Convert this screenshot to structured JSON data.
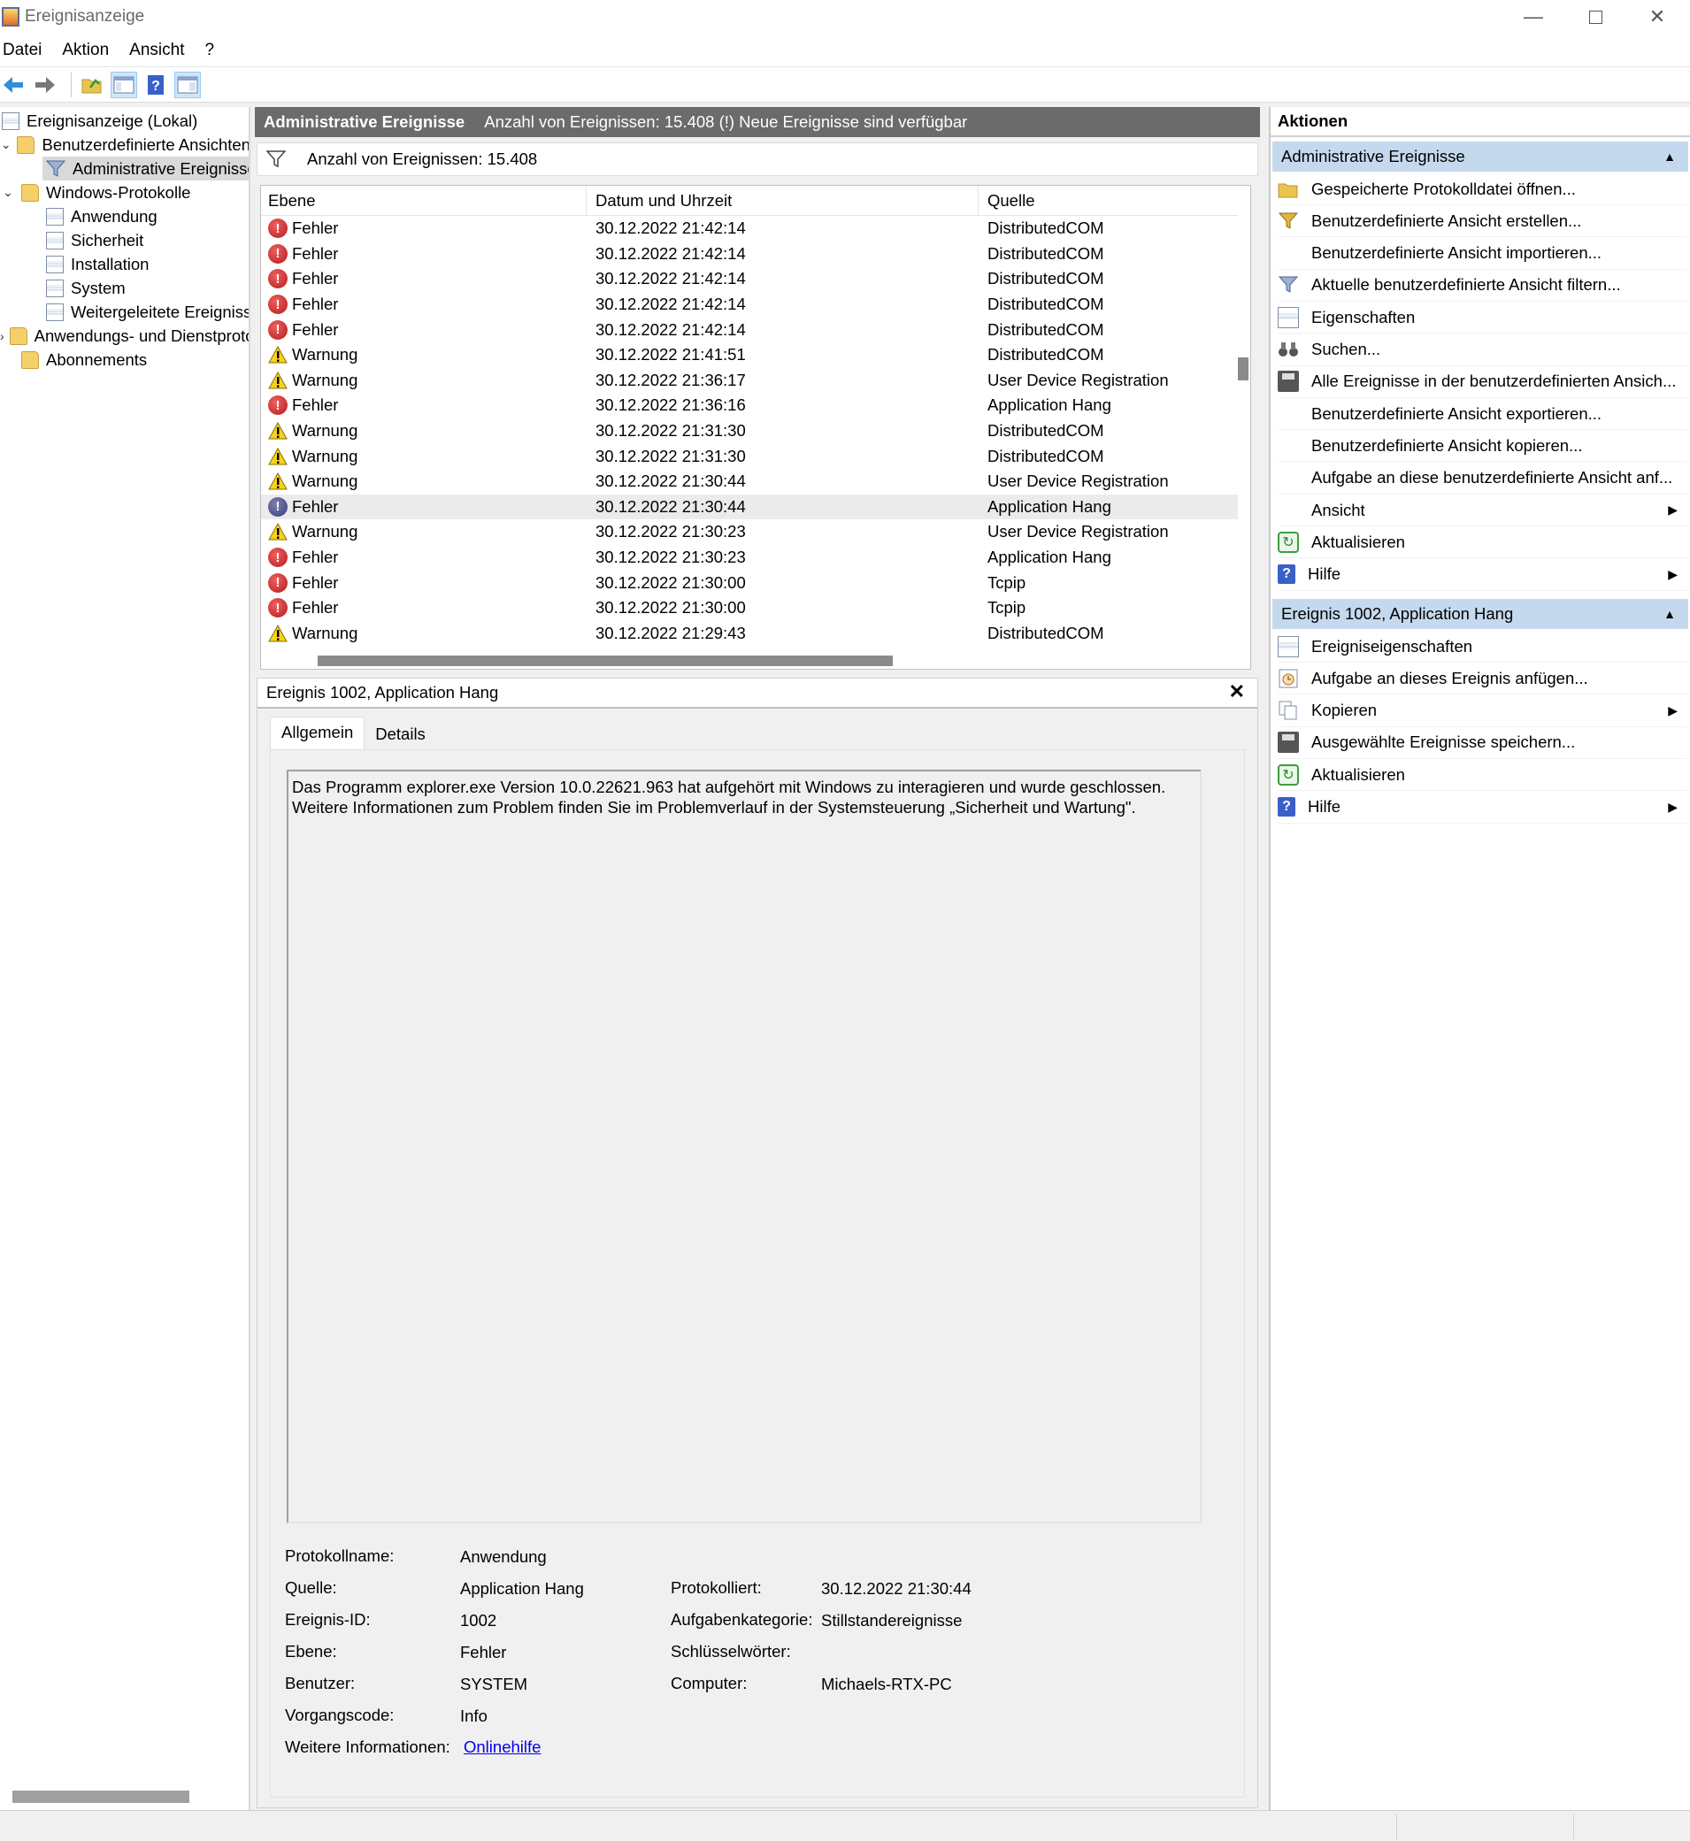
{
  "window": {
    "title": "Ereignisanzeige",
    "minimize_icon": "minimize-icon",
    "maximize_icon": "maximize-icon",
    "close_icon": "close-icon"
  },
  "menu": [
    "Datei",
    "Aktion",
    "Ansicht",
    "?"
  ],
  "toolbar": {
    "icons": [
      "back-arrow-icon",
      "forward-arrow-icon",
      "open-folder-icon",
      "console-tree-icon",
      "help-icon",
      "action-pane-icon"
    ]
  },
  "tree": {
    "root": "Ereignisanzeige (Lokal)",
    "custom_views": "Benutzerdefinierte Ansichten",
    "admin_events": "Administrative Ereignisse",
    "windows_logs": "Windows-Protokolle",
    "logs": [
      "Anwendung",
      "Sicherheit",
      "Installation",
      "System",
      "Weitergeleitete Ereignisse"
    ],
    "app_service_logs": "Anwendungs- und Dienstprotokolle",
    "subscriptions": "Abonnements"
  },
  "center": {
    "header_title": "Administrative Ereignisse",
    "header_info": "Anzahl von Ereignissen: 15.408 (!) Neue Ereignisse sind verfügbar",
    "filter_count": "Anzahl von Ereignissen: 15.408",
    "columns": [
      "Ebene",
      "Datum und Uhrzeit",
      "Quelle"
    ],
    "rows": [
      {
        "level": "Fehler",
        "type": "error",
        "datetime": "30.12.2022 21:42:14",
        "source": "DistributedCOM"
      },
      {
        "level": "Fehler",
        "type": "error",
        "datetime": "30.12.2022 21:42:14",
        "source": "DistributedCOM"
      },
      {
        "level": "Fehler",
        "type": "error",
        "datetime": "30.12.2022 21:42:14",
        "source": "DistributedCOM"
      },
      {
        "level": "Fehler",
        "type": "error",
        "datetime": "30.12.2022 21:42:14",
        "source": "DistributedCOM"
      },
      {
        "level": "Fehler",
        "type": "error",
        "datetime": "30.12.2022 21:42:14",
        "source": "DistributedCOM"
      },
      {
        "level": "Warnung",
        "type": "warning",
        "datetime": "30.12.2022 21:41:51",
        "source": "DistributedCOM"
      },
      {
        "level": "Warnung",
        "type": "warning",
        "datetime": "30.12.2022 21:36:17",
        "source": "User Device Registration"
      },
      {
        "level": "Fehler",
        "type": "error",
        "datetime": "30.12.2022 21:36:16",
        "source": "Application Hang"
      },
      {
        "level": "Warnung",
        "type": "warning",
        "datetime": "30.12.2022 21:31:30",
        "source": "DistributedCOM"
      },
      {
        "level": "Warnung",
        "type": "warning",
        "datetime": "30.12.2022 21:31:30",
        "source": "DistributedCOM"
      },
      {
        "level": "Warnung",
        "type": "warning",
        "datetime": "30.12.2022 21:30:44",
        "source": "User Device Registration"
      },
      {
        "level": "Fehler",
        "type": "error",
        "datetime": "30.12.2022 21:30:44",
        "source": "Application Hang",
        "selected": true
      },
      {
        "level": "Warnung",
        "type": "warning",
        "datetime": "30.12.2022 21:30:23",
        "source": "User Device Registration"
      },
      {
        "level": "Fehler",
        "type": "error",
        "datetime": "30.12.2022 21:30:23",
        "source": "Application Hang"
      },
      {
        "level": "Fehler",
        "type": "error",
        "datetime": "30.12.2022 21:30:00",
        "source": "Tcpip"
      },
      {
        "level": "Fehler",
        "type": "error",
        "datetime": "30.12.2022 21:30:00",
        "source": "Tcpip"
      },
      {
        "level": "Warnung",
        "type": "warning",
        "datetime": "30.12.2022 21:29:43",
        "source": "DistributedCOM"
      }
    ]
  },
  "detail": {
    "title": "Ereignis 1002, Application Hang",
    "tabs": [
      "Allgemein",
      "Details"
    ],
    "description": "Das Programm explorer.exe Version 10.0.22621.963 hat aufgehört mit Windows zu interagieren und wurde geschlossen. Weitere Informationen zum Problem finden Sie im Problemverlauf in der Systemsteuerung „Sicherheit und Wartung\".",
    "labels": {
      "logname": "Protokollname:",
      "source": "Quelle:",
      "event_id": "Ereignis-ID:",
      "level": "Ebene:",
      "user": "Benutzer:",
      "opcode": "Vorgangscode:",
      "more_info": "Weitere Informationen:",
      "logged": "Protokolliert:",
      "task_category": "Aufgabenkategorie:",
      "keywords": "Schlüsselwörter:",
      "computer": "Computer:"
    },
    "values": {
      "logname": "Anwendung",
      "source": "Application Hang",
      "event_id": "1002",
      "level": "Fehler",
      "user": "SYSTEM",
      "opcode": "Info",
      "more_info_link": "Onlinehilfe",
      "logged": "30.12.2022 21:30:44",
      "task_category": "Stillstandereignisse",
      "keywords": "",
      "computer": "Michaels-RTX-PC"
    }
  },
  "actions": {
    "title": "Aktionen",
    "section1": {
      "title": "Administrative Ereignisse",
      "items": [
        {
          "label": "Gespeicherte Protokolldatei öffnen...",
          "icon": "open-folder-icon"
        },
        {
          "label": "Benutzerdefinierte Ansicht erstellen...",
          "icon": "create-filter-icon"
        },
        {
          "label": "Benutzerdefinierte Ansicht importieren...",
          "icon": ""
        },
        {
          "label": "Aktuelle benutzerdefinierte Ansicht filtern...",
          "icon": "filter-icon"
        },
        {
          "label": "Eigenschaften",
          "icon": "properties-icon"
        },
        {
          "label": "Suchen...",
          "icon": "binoculars-icon"
        },
        {
          "label": "Alle Ereignisse in der benutzerdefinierten Ansich...",
          "icon": "save-icon"
        },
        {
          "label": "Benutzerdefinierte Ansicht exportieren...",
          "icon": ""
        },
        {
          "label": "Benutzerdefinierte Ansicht kopieren...",
          "icon": ""
        },
        {
          "label": "Aufgabe an diese benutzerdefinierte Ansicht anf...",
          "icon": ""
        },
        {
          "label": "Ansicht",
          "icon": "",
          "submenu": true
        },
        {
          "label": "Aktualisieren",
          "icon": "refresh-icon"
        },
        {
          "label": "Hilfe",
          "icon": "help-icon",
          "submenu": true
        }
      ]
    },
    "section2": {
      "title": "Ereignis 1002, Application Hang",
      "items": [
        {
          "label": "Ereigniseigenschaften",
          "icon": "properties-icon"
        },
        {
          "label": "Aufgabe an dieses Ereignis anfügen...",
          "icon": "task-clock-icon"
        },
        {
          "label": "Kopieren",
          "icon": "copy-icon",
          "submenu": true
        },
        {
          "label": "Ausgewählte Ereignisse speichern...",
          "icon": "save-icon"
        },
        {
          "label": "Aktualisieren",
          "icon": "refresh-icon"
        },
        {
          "label": "Hilfe",
          "icon": "help-icon",
          "submenu": true
        }
      ]
    }
  },
  "colors": {
    "header_bg": "#6b6b6b",
    "section_bg": "#c5d9ee",
    "error_red": "#c62828",
    "warning_yellow": "#f7d21c",
    "link_blue": "#0000ee"
  }
}
